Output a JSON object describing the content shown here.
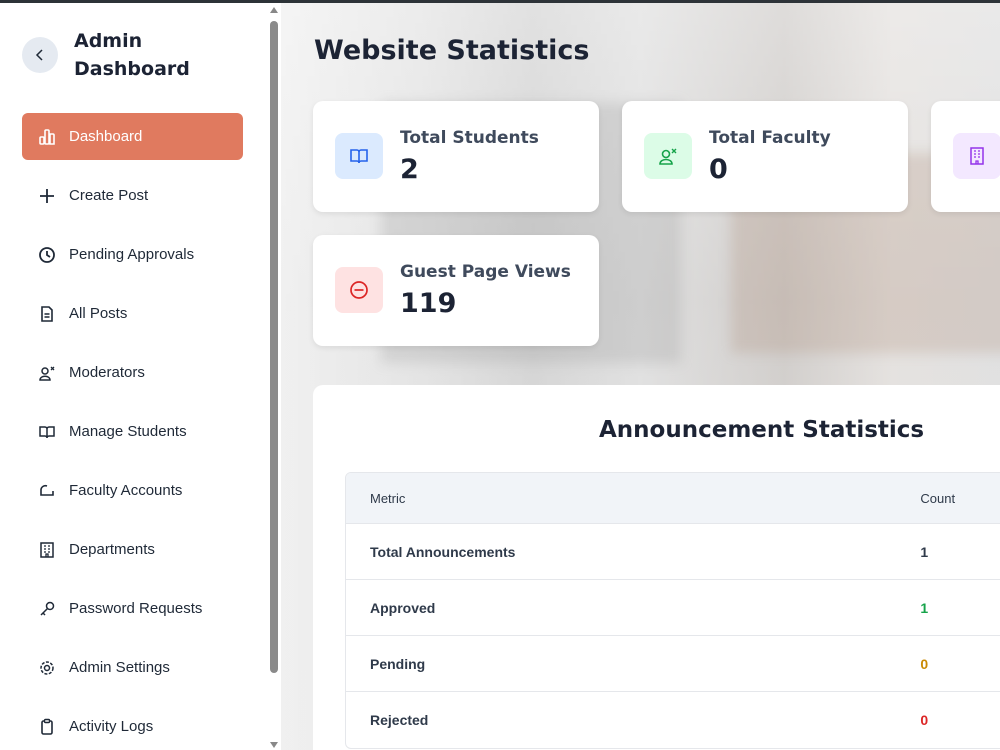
{
  "sidebar": {
    "title": "Admin Dashboard",
    "items": [
      {
        "label": "Dashboard",
        "icon": "chart-bar-icon",
        "active": true
      },
      {
        "label": "Create Post",
        "icon": "plus-icon"
      },
      {
        "label": "Pending Approvals",
        "icon": "clock-icon"
      },
      {
        "label": "All Posts",
        "icon": "document-icon"
      },
      {
        "label": "Moderators",
        "icon": "user-shield-icon"
      },
      {
        "label": "Manage Students",
        "icon": "book-open-icon"
      },
      {
        "label": "Faculty Accounts",
        "icon": "faculty-icon"
      },
      {
        "label": "Departments",
        "icon": "building-icon"
      },
      {
        "label": "Password Requests",
        "icon": "key-icon"
      },
      {
        "label": "Admin Settings",
        "icon": "gear-icon"
      },
      {
        "label": "Activity Logs",
        "icon": "clipboard-icon"
      }
    ]
  },
  "main": {
    "title": "Website Statistics",
    "stats": [
      {
        "label": "Total Students",
        "value": "2",
        "icon": "book-open-icon",
        "color": "#dbeafe"
      },
      {
        "label": "Total Faculty",
        "value": "0",
        "icon": "user-shield-icon",
        "color": "#dcfce7"
      },
      {
        "label": "",
        "value": "",
        "icon": "building-icon",
        "color": "#f3e8ff"
      },
      {
        "label": "Guest Page Views",
        "value": "119",
        "icon": "minus-circle-icon",
        "color": "#fee2e2"
      }
    ],
    "announcements": {
      "title": "Announcement Statistics",
      "headers": {
        "metric": "Metric",
        "count": "Count"
      },
      "rows": [
        {
          "metric": "Total Announcements",
          "count": "1",
          "color": "#2f3a4a"
        },
        {
          "metric": "Approved",
          "count": "1",
          "color": "#16a34a"
        },
        {
          "metric": "Pending",
          "count": "0",
          "color": "#ca8a04"
        },
        {
          "metric": "Rejected",
          "count": "0",
          "color": "#dc2626"
        }
      ]
    }
  },
  "colors": {
    "accent": "#e07a5f",
    "heading": "#1c2334"
  }
}
